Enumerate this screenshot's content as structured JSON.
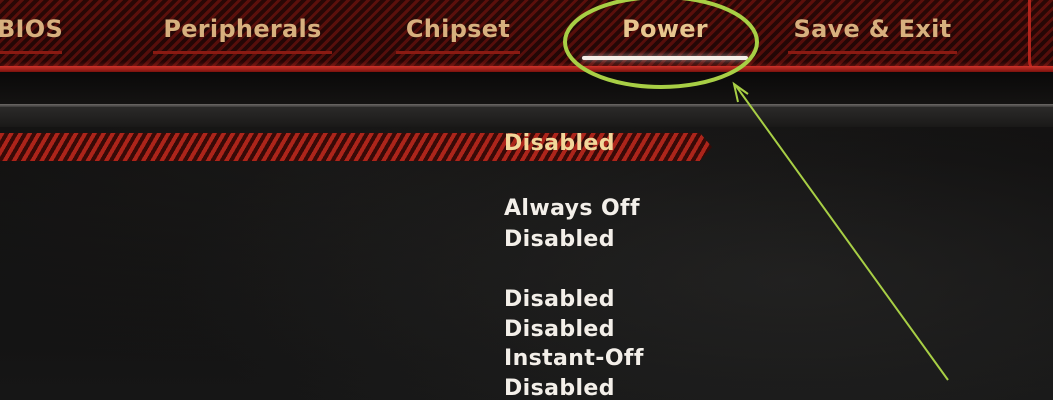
{
  "tabs": [
    {
      "label": "BIOS",
      "active": false
    },
    {
      "label": "Peripherals",
      "active": false
    },
    {
      "label": "Chipset",
      "active": false
    },
    {
      "label": "Power",
      "active": true
    },
    {
      "label": "Save & Exit",
      "active": false
    }
  ],
  "settings": {
    "values": [
      "Disabled",
      "Always Off",
      "Disabled",
      "Disabled",
      "Disabled",
      "Instant-Off",
      "Disabled"
    ],
    "selected_index": 0
  },
  "colors": {
    "accent_red": "#b9261b",
    "tab_text": "#d7b07e",
    "value_text": "#f3efe9",
    "annotation_green": "#a8cf45"
  }
}
